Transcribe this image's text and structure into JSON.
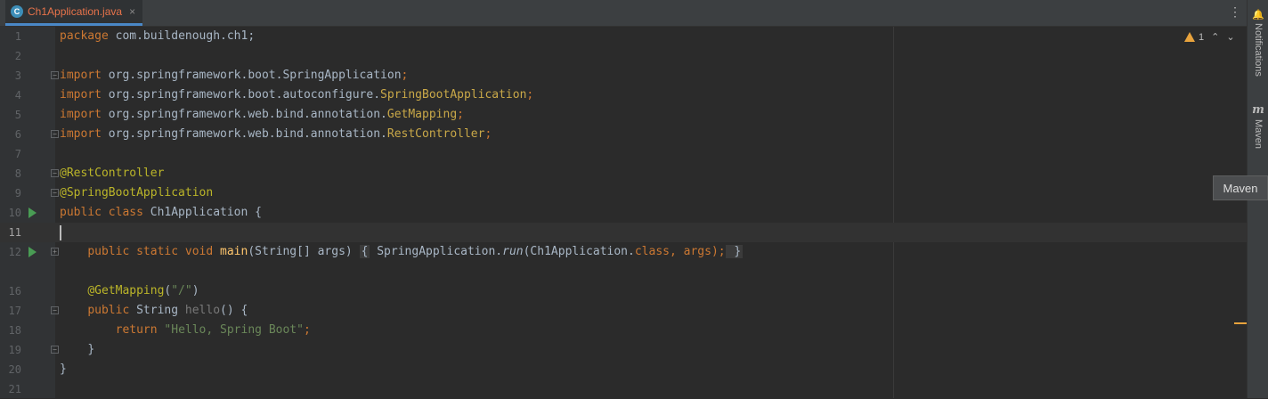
{
  "tab": {
    "icon": "java-class-icon",
    "icon_glyph": "C",
    "label": "Ch1Application.java",
    "close": "×"
  },
  "toolbar": {
    "more_glyph": "⋮"
  },
  "status": {
    "warnings": "1",
    "prev_glyph": "⌃",
    "next_glyph": "⌄"
  },
  "sidebar": {
    "notifications_label": "Notifications",
    "maven_label": "Maven",
    "bell_glyph": "🔔",
    "maven_glyph": "m"
  },
  "tooltip": {
    "text": "Maven"
  },
  "lines": {
    "n1": "1",
    "n2": "2",
    "n3": "3",
    "n4": "4",
    "n5": "5",
    "n6": "6",
    "n7": "7",
    "n8": "8",
    "n9": "9",
    "n10": "10",
    "n11": "11",
    "n12": "12",
    "n16": "16",
    "n17": "17",
    "n18": "18",
    "n19": "19",
    "n20": "20",
    "n21": "21"
  },
  "code": {
    "l1": {
      "kw": "package",
      "rest": " com.buildenough.ch1;"
    },
    "l3": {
      "kw": "import",
      "pkg": " org.springframework.boot.SpringApplication",
      "end": ";"
    },
    "l4": {
      "kw": "import",
      "pkg": " org.springframework.boot.autoconfigure.",
      "cls": "SpringBootApplication",
      "end": ";"
    },
    "l5": {
      "kw": "import",
      "pkg": " org.springframework.web.bind.annotation.",
      "cls": "GetMapping",
      "end": ";"
    },
    "l6": {
      "kw": "import",
      "pkg": " org.springframework.web.bind.annotation.",
      "cls": "RestController",
      "end": ";"
    },
    "l8": {
      "ann": "@RestController"
    },
    "l9": {
      "ann": "@SpringBootApplication"
    },
    "l10": {
      "kw": "public class",
      "rest": " Ch1Application {"
    },
    "l12": {
      "indent": "    ",
      "kw": "public static void",
      "fn": " main",
      "args": "(String[] args) ",
      "ob": "{",
      "body1": " SpringApplication.",
      "run": "run",
      "body2": "(Ch1Application.",
      "cls": "class",
      "body3": ", args);",
      "cb": " }"
    },
    "l16": {
      "indent": "    ",
      "ann": "@GetMapping",
      "p1": "(",
      "str": "\"/\"",
      "p2": ")"
    },
    "l17": {
      "indent": "    ",
      "kw": "public",
      "type": " String ",
      "fn": "hello",
      "rest": "() {"
    },
    "l18": {
      "indent": "        ",
      "kw": "return",
      "str": " \"Hello, Spring Boot\"",
      "end": ";"
    },
    "l19": {
      "indent": "    ",
      "rest": "}"
    },
    "l20": {
      "rest": "}"
    }
  }
}
